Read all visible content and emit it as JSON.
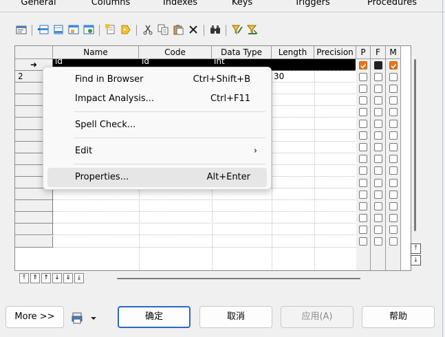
{
  "tabs": [
    "General",
    "Columns",
    "Indexes",
    "Keys",
    "Triggers",
    "Procedures"
  ],
  "toolbar_icons": [
    "properties-icon",
    "insert-row-icon",
    "add-row-icon",
    "add-columns-icon",
    "add-domain-icon",
    "new-icon",
    "paste-attr-icon",
    "cut-icon",
    "copy-icon",
    "paste-icon",
    "delete-icon",
    "find-icon",
    "filter-icon",
    "clear-filter-icon"
  ],
  "grid": {
    "columns": [
      "Name",
      "Code",
      "Data Type",
      "Length",
      "Precision",
      "P",
      "F",
      "M"
    ],
    "rows": [
      {
        "marker": "➜",
        "name": "id",
        "code": "id",
        "type": "int",
        "length": "",
        "precision": "",
        "p": true,
        "f": false,
        "m": true
      },
      {
        "marker": "2",
        "name": "",
        "code": "",
        "type": "",
        "length": "30",
        "precision": "",
        "p": false,
        "f": false,
        "m": false
      }
    ],
    "empty_rows": 14
  },
  "context_menu": {
    "groups": [
      [
        {
          "label": "Find in Browser",
          "shortcut": "Ctrl+Shift+B"
        },
        {
          "label": "Impact Analysis...",
          "shortcut": "Ctrl+F11"
        }
      ],
      [
        {
          "label": "Spell Check...",
          "shortcut": ""
        }
      ],
      [
        {
          "label": "Edit",
          "shortcut": "",
          "submenu": true
        }
      ],
      [
        {
          "label": "Properties...",
          "shortcut": "Alt+Enter",
          "hover": true
        }
      ]
    ]
  },
  "nav_buttons": [
    "⤒",
    "⇑",
    "↑",
    "↓",
    "⇓",
    "⤓"
  ],
  "buttons": {
    "more": "More >>",
    "ok": "确定",
    "cancel": "取消",
    "apply": "应用(A)",
    "help": "帮助"
  }
}
